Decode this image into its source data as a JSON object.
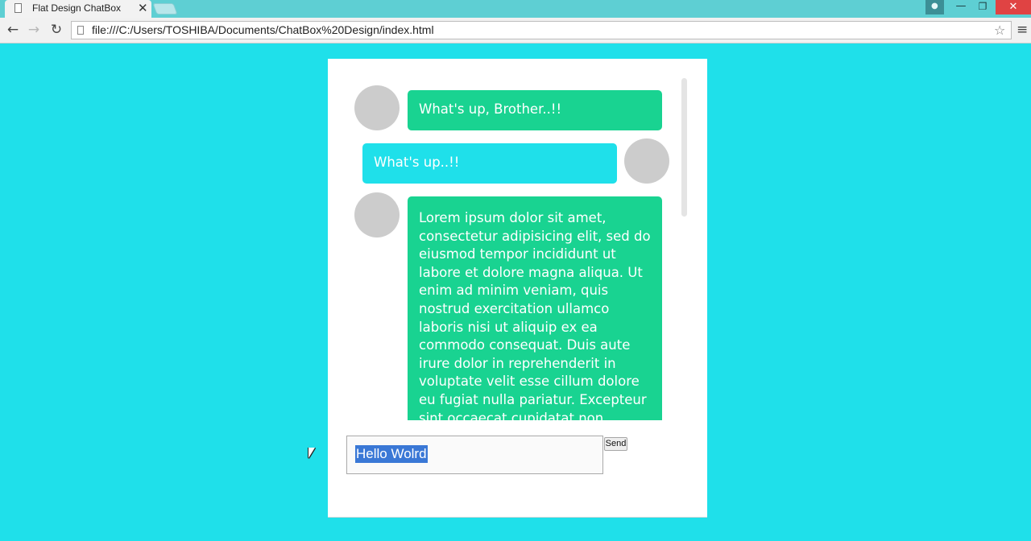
{
  "browser": {
    "tab_title": "Flat Design ChatBox",
    "tab_close_glyph": "✕",
    "address": "file:///C:/Users/TOSHIBA/Documents/ChatBox%20Design/index.html",
    "nav": {
      "back_glyph": "←",
      "forward_glyph": "→",
      "reload_glyph": "↻"
    },
    "star_glyph": "☆",
    "menu_glyph": "≡",
    "window": {
      "min_glyph": "—",
      "max_glyph": "❐",
      "close_glyph": "✕",
      "user_glyph": "●"
    }
  },
  "chat": {
    "colors": {
      "page_bg": "#1fe0ea",
      "green": "#19d391",
      "cyan": "#1fe0ea",
      "avatar": "#cccccc"
    },
    "messages": [
      {
        "side": "left",
        "color": "green",
        "text": "What's up, Brother..!!"
      },
      {
        "side": "right",
        "color": "cyan",
        "text": "What's up..!!"
      },
      {
        "side": "left",
        "color": "green",
        "text": "Lorem ipsum dolor sit amet, consectetur adipisicing elit, sed do eiusmod tempor incididunt ut labore et dolore magna aliqua. Ut enim ad minim veniam, quis nostrud exercitation ullamco laboris nisi ut aliquip ex ea commodo consequat. Duis aute irure dolor in reprehenderit in voluptate velit esse cillum dolore eu fugiat nulla pariatur. Excepteur sint occaecat cupidatat non"
      }
    ],
    "input": {
      "value": "Hello Wolrd"
    },
    "send_label": "Send"
  }
}
